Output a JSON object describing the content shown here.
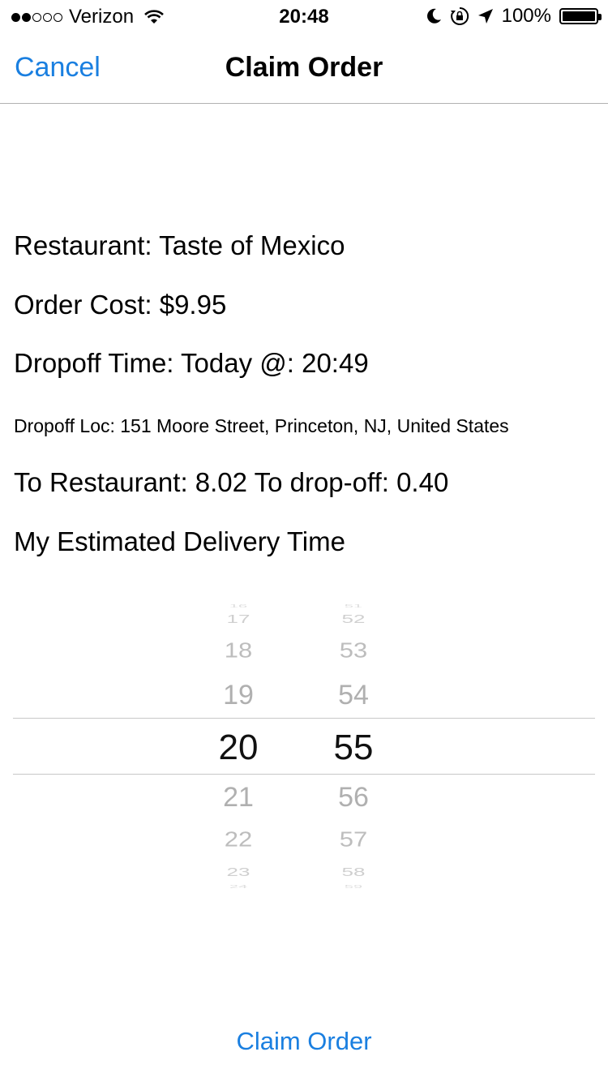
{
  "status_bar": {
    "carrier": "Verizon",
    "time": "20:48",
    "battery": "100%",
    "signal_bars_filled": 2,
    "signal_bars_total": 5
  },
  "nav": {
    "cancel_label": "Cancel",
    "title": "Claim Order"
  },
  "order": {
    "restaurant": "Restaurant: Taste of Mexico",
    "cost": "Order Cost: $9.95",
    "dropoff_time": "Dropoff Time: Today @: 20:49",
    "dropoff_loc": "Dropoff Loc: 151 Moore Street, Princeton, NJ, United States",
    "distances": "To Restaurant: 8.02 To drop-off: 0.40",
    "estimate_label": "My Estimated Delivery Time"
  },
  "picker": {
    "hours": [
      "16",
      "17",
      "18",
      "19",
      "20",
      "21",
      "22",
      "23",
      "24"
    ],
    "minutes": [
      "51",
      "52",
      "53",
      "54",
      "55",
      "56",
      "57",
      "58",
      "59"
    ],
    "selected_hour": "20",
    "selected_minute": "55"
  },
  "footer": {
    "claim_label": "Claim Order"
  },
  "colors": {
    "accent": "#1a7fe0",
    "divider": "#b2b2b2"
  }
}
